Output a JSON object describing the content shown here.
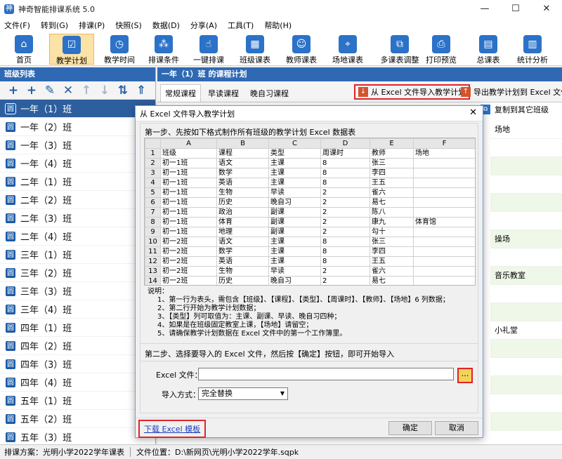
{
  "app": {
    "title": "神奇智能排课系统 5.0"
  },
  "window": {
    "minimize": "—",
    "maximize": "☐",
    "close": "✕"
  },
  "menu": [
    "文件(F)",
    "转到(G)",
    "排课(P)",
    "快照(S)",
    "数据(D)",
    "分享(A)",
    "工具(T)",
    "帮助(H)"
  ],
  "toolbar": [
    {
      "label": "首页",
      "icon": "home-icon",
      "glyph": "⌂"
    },
    {
      "label": "教学计划",
      "icon": "clipboard-icon",
      "glyph": "☑",
      "active": true
    },
    {
      "label": "教学时间",
      "icon": "clock-icon",
      "glyph": "◷"
    },
    {
      "label": "排课条件",
      "icon": "conditions-icon",
      "glyph": "⁂"
    },
    {
      "label": "一键排课",
      "icon": "hand-tap-icon",
      "glyph": "☝"
    },
    {
      "label": "班级课表",
      "icon": "calendar-icon",
      "glyph": "▦"
    },
    {
      "label": "教师课表",
      "icon": "teacher-icon",
      "glyph": "☺"
    },
    {
      "label": "场地课表",
      "icon": "location-icon",
      "glyph": "⌖"
    },
    {
      "label": "多课表调整",
      "icon": "multi-schedule-icon",
      "glyph": "⧉"
    },
    {
      "label": "打印预览",
      "icon": "printer-icon",
      "glyph": "⎙"
    },
    {
      "label": "总课表",
      "icon": "grid-icon",
      "glyph": "▤"
    },
    {
      "label": "统计分析",
      "icon": "bar-chart-icon",
      "glyph": "▥"
    }
  ],
  "left_panel": {
    "title": "班级列表",
    "tools": [
      {
        "name": "add-icon",
        "glyph": "+",
        "color": "#1f5fa8"
      },
      {
        "name": "add-multiple-icon",
        "glyph": "+",
        "color": "#1f5fa8"
      },
      {
        "name": "edit-icon",
        "glyph": "✎",
        "color": "#1f5fa8"
      },
      {
        "name": "delete-icon",
        "glyph": "✕",
        "color": "#1f5fa8"
      },
      {
        "name": "move-up-icon",
        "glyph": "↑",
        "color": "#a9b4c4"
      },
      {
        "name": "move-down-icon",
        "glyph": "↓",
        "color": "#a9b4c4"
      },
      {
        "name": "sort-icon",
        "glyph": "⇅",
        "color": "#1f5fa8"
      },
      {
        "name": "upload-icon",
        "glyph": "⇑",
        "color": "#1f5fa8"
      }
    ],
    "class_icon_glyph": "圆",
    "classes": [
      "一年（1）班",
      "一年（2）班",
      "一年（3）班",
      "一年（4）班",
      "二年（1）班",
      "二年（2）班",
      "二年（3）班",
      "二年（4）班",
      "三年（1）班",
      "三年（2）班",
      "三年（3）班",
      "三年（4）班",
      "四年（1）班",
      "四年（2）班",
      "四年（3）班",
      "四年（4）班",
      "五年（1）班",
      "五年（2）班",
      "五年（3）班"
    ]
  },
  "right_panel": {
    "title": "一年（1）班 的课程计划",
    "tabs": [
      "常规课程",
      "早读课程",
      "晚自习课程"
    ],
    "import_label": "从 Excel 文件导入教学计划",
    "export_label": "导出教学计划到 Excel 文件",
    "copy_label": "复制到其它班级",
    "venue_header": "场地",
    "venues": [
      "",
      "",
      "",
      "",
      "",
      "操场",
      "",
      "音乐教室",
      "",
      "",
      "小礼堂",
      "",
      "",
      "",
      "",
      ""
    ]
  },
  "dialog": {
    "title": "从 Excel 文件导入教学计划",
    "close": "✕",
    "step1_label": "第一步、先按如下格式制作所有班级的教学计划 Excel 数据表",
    "columns": [
      "",
      "A",
      "B",
      "C",
      "D",
      "E",
      "F"
    ],
    "rows": [
      [
        "1",
        "班级",
        "课程",
        "类型",
        "周课时",
        "教师",
        "场地"
      ],
      [
        "2",
        "初一1班",
        "语文",
        "主课",
        "8",
        "张三",
        ""
      ],
      [
        "3",
        "初一1班",
        "数学",
        "主课",
        "8",
        "李四",
        ""
      ],
      [
        "4",
        "初一1班",
        "英语",
        "主课",
        "8",
        "王五",
        ""
      ],
      [
        "5",
        "初一1班",
        "生物",
        "早读",
        "2",
        "雀六",
        ""
      ],
      [
        "6",
        "初一1班",
        "历史",
        "晚自习",
        "2",
        "易七",
        ""
      ],
      [
        "7",
        "初一1班",
        "政治",
        "副课",
        "2",
        "陈八",
        ""
      ],
      [
        "8",
        "初一1班",
        "体育",
        "副课",
        "2",
        "康九",
        "体育馆"
      ],
      [
        "9",
        "初一1班",
        "地理",
        "副课",
        "2",
        "勾十",
        ""
      ],
      [
        "10",
        "初一2班",
        "语文",
        "主课",
        "8",
        "张三",
        ""
      ],
      [
        "11",
        "初一2班",
        "数学",
        "主课",
        "8",
        "李四",
        ""
      ],
      [
        "12",
        "初一2班",
        "英语",
        "主课",
        "8",
        "王五",
        ""
      ],
      [
        "13",
        "初一2班",
        "生物",
        "早读",
        "2",
        "雀六",
        ""
      ],
      [
        "14",
        "初一2班",
        "历史",
        "晚自习",
        "2",
        "易七",
        ""
      ]
    ],
    "notes_title": "说明：",
    "notes": [
      "1、第一行为表头，需包含【班级】、【课程】、【类型】、【周课时】、【教师】、【场地】6 列数据；",
      "2、第二行开始为教学计划数据；",
      "3、【类型】列可取值为：主课、副课、早读、晚自习四种；",
      "4、如果是在班级固定教室上课，【场地】请留空；",
      "5、请确保教学计划数据在 Excel 文件中的第一个工作簿里。"
    ],
    "step2_label": "第二步、选择要导入的 Excel 文件，然后按【确定】按钮，即可开始导入",
    "file_label": "Excel 文件：",
    "file_value": "",
    "browse": "…",
    "mode_label": "导入方式：",
    "mode_value": "完全替换",
    "download_link": "下载 Excel 模板",
    "ok": "确定",
    "cancel": "取消"
  },
  "status": {
    "plan": "排课方案：光明小学2022学年课表",
    "file": "文件位置：D:\\新网页\\光明小学2022学年.sqpk"
  }
}
